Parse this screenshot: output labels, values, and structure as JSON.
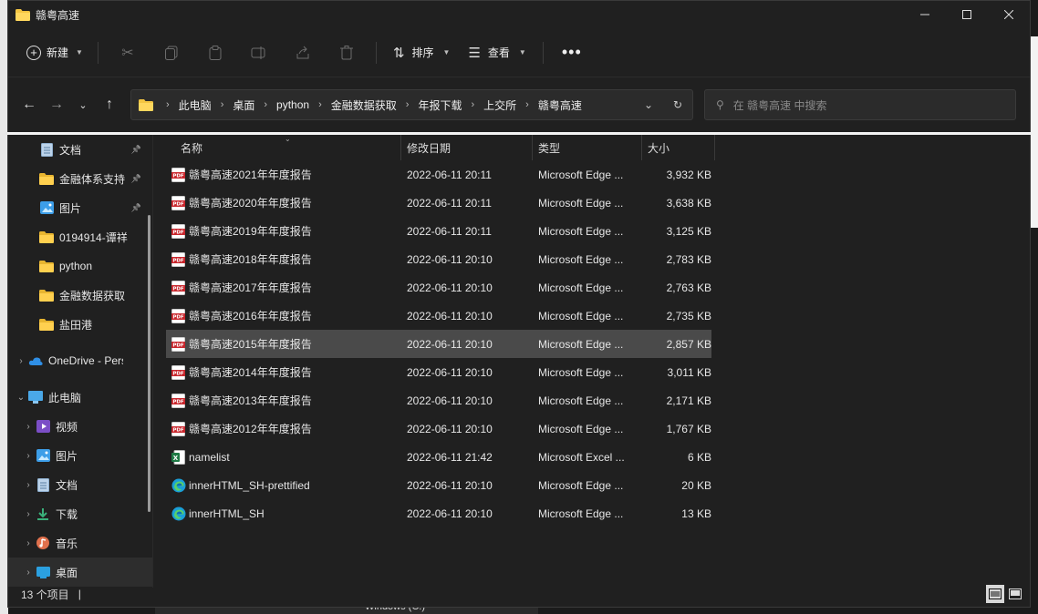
{
  "window": {
    "title": "赣粤高速"
  },
  "command_bar": {
    "new_label": "新建",
    "sort_label": "排序",
    "view_label": "查看"
  },
  "address": {
    "breadcrumbs": [
      "此电脑",
      "桌面",
      "python",
      "金融数据获取",
      "年报下载",
      "上交所",
      "赣粤高速"
    ]
  },
  "search": {
    "placeholder": "在 赣粤高速 中搜索"
  },
  "sidebar": {
    "quick": [
      {
        "label": "文档",
        "pinned": true
      },
      {
        "label": "金融体系支持",
        "pinned": true
      },
      {
        "label": "图片",
        "pinned": true
      },
      {
        "label": "0194914-谭祥",
        "pinned": false
      },
      {
        "label": "python",
        "pinned": false
      },
      {
        "label": "金融数据获取",
        "pinned": false
      },
      {
        "label": "盐田港",
        "pinned": false
      }
    ],
    "onedrive": "OneDrive - Pers",
    "thispc": "此电脑",
    "pc_items": [
      "视频",
      "图片",
      "文档",
      "下载",
      "音乐",
      "桌面"
    ]
  },
  "columns": {
    "name": "名称",
    "date": "修改日期",
    "type": "类型",
    "size": "大小"
  },
  "files": [
    {
      "name": "赣粤高速2021年年度报告",
      "date": "2022-06-11 20:11",
      "type": "Microsoft Edge ...",
      "size": "3,932 KB",
      "icon": "pdf"
    },
    {
      "name": "赣粤高速2020年年度报告",
      "date": "2022-06-11 20:11",
      "type": "Microsoft Edge ...",
      "size": "3,638 KB",
      "icon": "pdf"
    },
    {
      "name": "赣粤高速2019年年度报告",
      "date": "2022-06-11 20:11",
      "type": "Microsoft Edge ...",
      "size": "3,125 KB",
      "icon": "pdf"
    },
    {
      "name": "赣粤高速2018年年度报告",
      "date": "2022-06-11 20:10",
      "type": "Microsoft Edge ...",
      "size": "2,783 KB",
      "icon": "pdf"
    },
    {
      "name": "赣粤高速2017年年度报告",
      "date": "2022-06-11 20:10",
      "type": "Microsoft Edge ...",
      "size": "2,763 KB",
      "icon": "pdf"
    },
    {
      "name": "赣粤高速2016年年度报告",
      "date": "2022-06-11 20:10",
      "type": "Microsoft Edge ...",
      "size": "2,735 KB",
      "icon": "pdf"
    },
    {
      "name": "赣粤高速2015年年度报告",
      "date": "2022-06-11 20:10",
      "type": "Microsoft Edge ...",
      "size": "2,857 KB",
      "icon": "pdf",
      "selected": true
    },
    {
      "name": "赣粤高速2014年年度报告",
      "date": "2022-06-11 20:10",
      "type": "Microsoft Edge ...",
      "size": "3,011 KB",
      "icon": "pdf"
    },
    {
      "name": "赣粤高速2013年年度报告",
      "date": "2022-06-11 20:10",
      "type": "Microsoft Edge ...",
      "size": "2,171 KB",
      "icon": "pdf"
    },
    {
      "name": "赣粤高速2012年年度报告",
      "date": "2022-06-11 20:10",
      "type": "Microsoft Edge ...",
      "size": "1,767 KB",
      "icon": "pdf"
    },
    {
      "name": "namelist",
      "date": "2022-06-11 21:42",
      "type": "Microsoft Excel ...",
      "size": "6 KB",
      "icon": "excel"
    },
    {
      "name": "innerHTML_SH-prettified",
      "date": "2022-06-11 20:10",
      "type": "Microsoft Edge ...",
      "size": "20 KB",
      "icon": "edge"
    },
    {
      "name": "innerHTML_SH",
      "date": "2022-06-11 20:10",
      "type": "Microsoft Edge ...",
      "size": "13 KB",
      "icon": "edge"
    }
  ],
  "status": {
    "count": "13 个项目"
  },
  "background": {
    "taskbar_text": "Windows (C:)"
  }
}
